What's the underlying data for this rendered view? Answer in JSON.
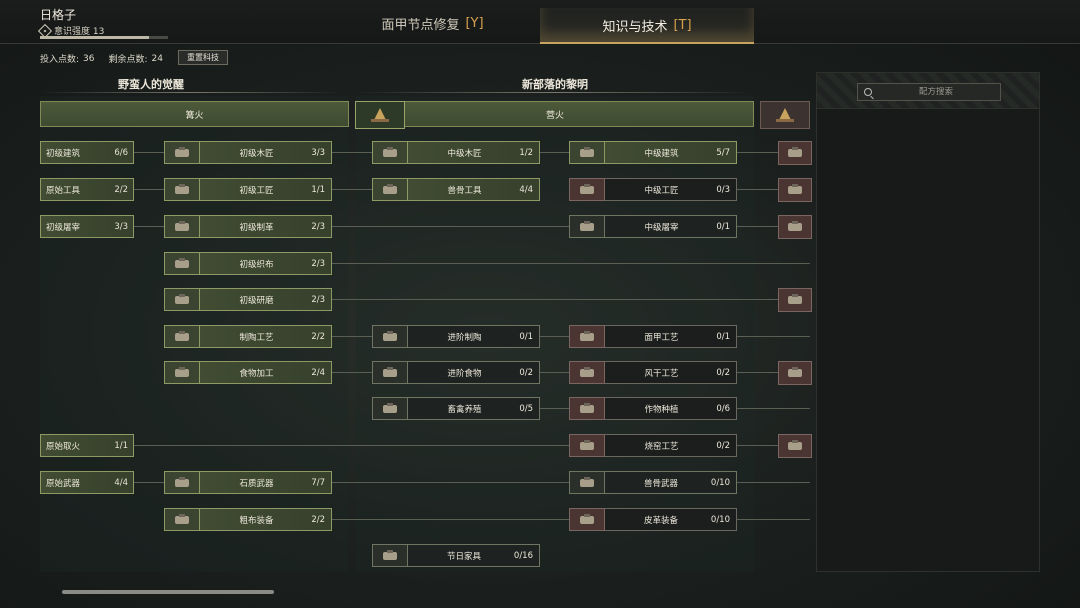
{
  "header": {
    "player_name": "日格子",
    "awareness_label": "意识强度 13",
    "xp_fraction": 0.85,
    "tabs": [
      {
        "label": "面甲节点修复",
        "key": "[Y]"
      },
      {
        "label": "知识与技术",
        "key": "[T]"
      }
    ]
  },
  "stats": {
    "invested_label": "投入点数:",
    "invested_value": "36",
    "remaining_label": "剩余点数:",
    "remaining_value": "24",
    "reset_label": "重置科技"
  },
  "eras": [
    {
      "title": "野蛮人的觉醒",
      "campfire": "篝火"
    },
    {
      "title": "新部落的黎明",
      "campfire": "营火"
    }
  ],
  "left_column": [
    {
      "name": "初级建筑",
      "count": "6/6"
    },
    {
      "name": "原始工具",
      "count": "2/2"
    },
    {
      "name": "初级屠宰",
      "count": "3/3"
    },
    {
      "name": "原始取火",
      "count": "1/1"
    },
    {
      "name": "原始武器",
      "count": "4/4"
    }
  ],
  "col2": [
    {
      "name": "初级木匠",
      "count": "3/3",
      "icon": "workbench-icon"
    },
    {
      "name": "初级工匠",
      "count": "1/1",
      "icon": "chest-icon"
    },
    {
      "name": "初级制革",
      "count": "2/3",
      "icon": "hide-rack-icon"
    },
    {
      "name": "初级织布",
      "count": "2/3",
      "icon": "loom-icon"
    },
    {
      "name": "初级研磨",
      "count": "2/3",
      "icon": "grindstone-icon"
    },
    {
      "name": "制陶工艺",
      "count": "2/2",
      "icon": "pottery-icon"
    },
    {
      "name": "食物加工",
      "count": "2/4",
      "icon": "cooking-pot-icon"
    },
    {
      "name": "石质武器",
      "count": "7/7",
      "icon": "stone-spear-icon"
    },
    {
      "name": "粗布装备",
      "count": "2/2",
      "icon": "cloth-armor-icon"
    }
  ],
  "col3": [
    {
      "name": "中级木匠",
      "count": "1/2",
      "icon": "saw-bench-icon"
    },
    {
      "name": "兽骨工具",
      "count": "4/4",
      "icon": "bone-axe-icon"
    },
    {
      "name": "进阶制陶",
      "count": "0/1",
      "icon": "kiln-icon"
    },
    {
      "name": "进阶食物",
      "count": "0/2",
      "icon": "cauldron-icon"
    },
    {
      "name": "畜禽养殖",
      "count": "0/5",
      "icon": "trough-icon"
    },
    {
      "name": "节日家具",
      "count": "0/16",
      "icon": "festival-tree-icon"
    }
  ],
  "col4": [
    {
      "name": "中级建筑",
      "count": "5/7",
      "icon": "wall-icon"
    },
    {
      "name": "中级工匠",
      "count": "0/3",
      "icon": "tool-chest-icon"
    },
    {
      "name": "中级屠宰",
      "count": "0/1",
      "icon": "butcher-table-icon"
    },
    {
      "name": "面甲工艺",
      "count": "0/1",
      "icon": "mask-bench-icon"
    },
    {
      "name": "风干工艺",
      "count": "0/2",
      "icon": "drying-rack-icon"
    },
    {
      "name": "作物种植",
      "count": "0/6",
      "icon": "planter-icon"
    },
    {
      "name": "烧窑工艺",
      "count": "0/2",
      "icon": "furnace-icon"
    },
    {
      "name": "兽骨武器",
      "count": "0/10",
      "icon": "bone-spear-icon"
    },
    {
      "name": "皮革装备",
      "count": "0/10",
      "icon": "leather-armor-icon"
    }
  ],
  "panel": {
    "search_placeholder": "配方搜索"
  }
}
